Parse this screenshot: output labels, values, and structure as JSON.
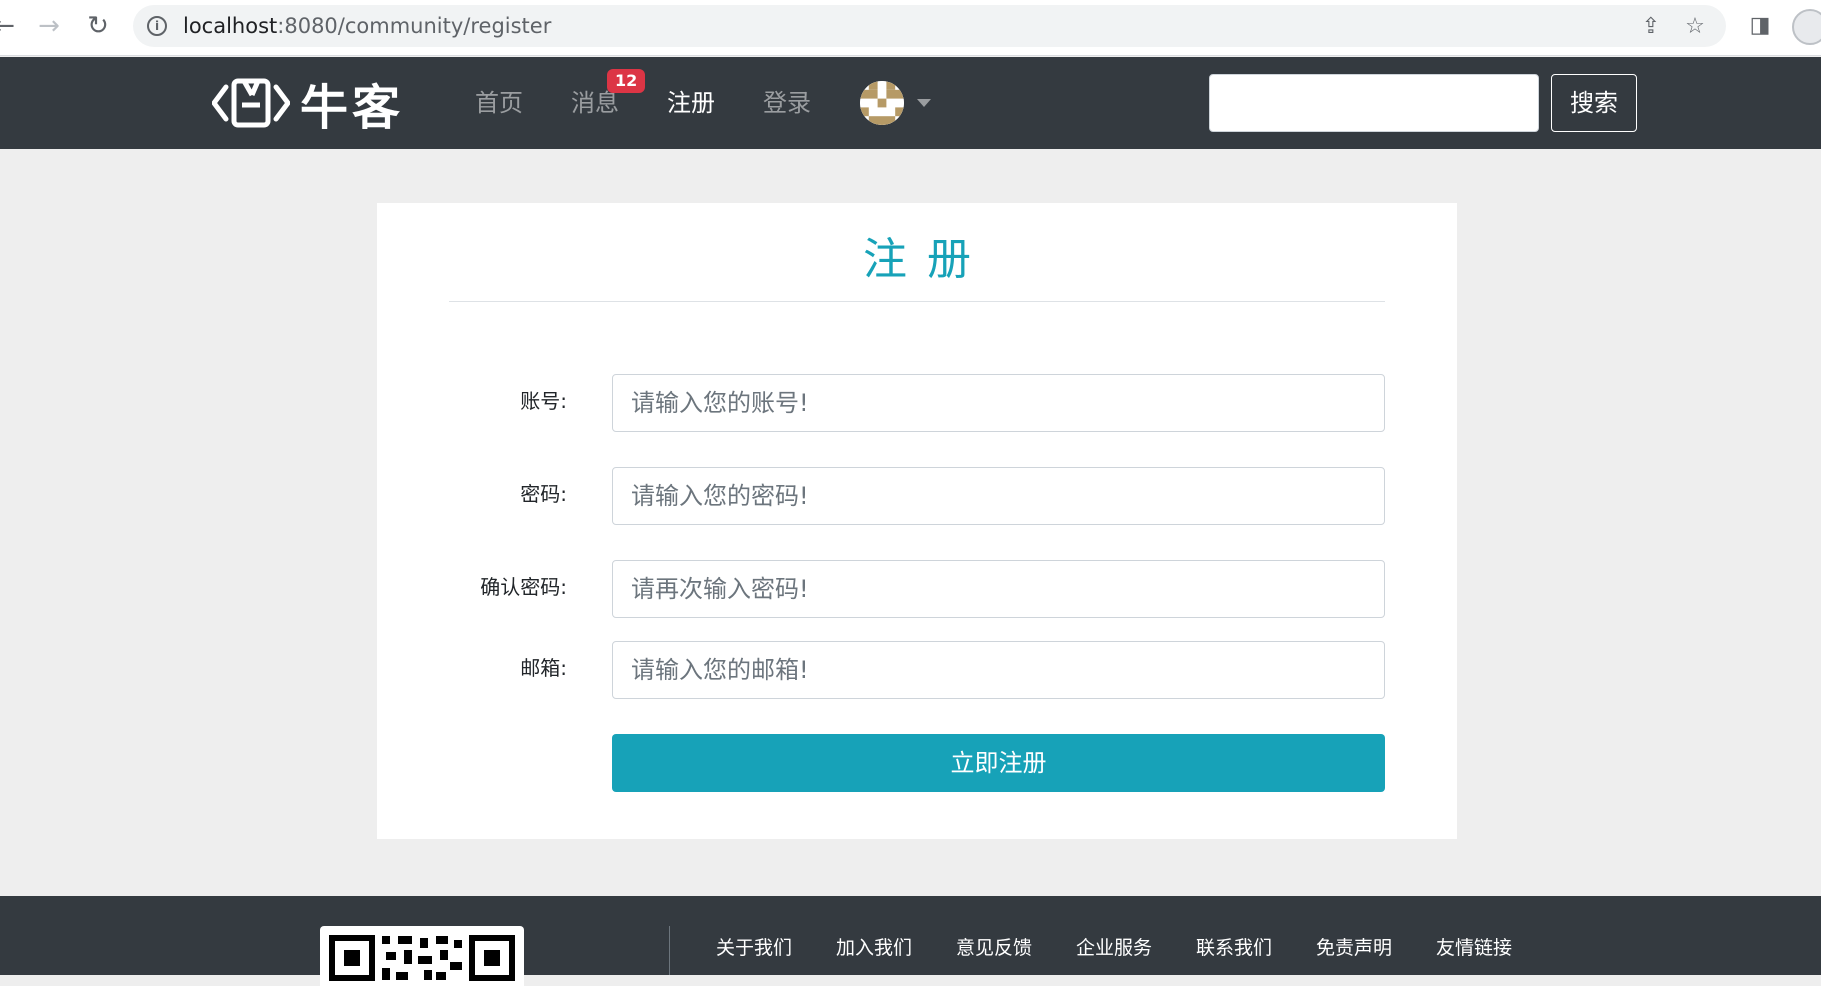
{
  "browser": {
    "url_host": "localhost",
    "url_rest": ":8080/community/register"
  },
  "header": {
    "logo_text": "牛客",
    "nav": [
      {
        "label": "首页"
      },
      {
        "label": "消息"
      },
      {
        "label": "注册"
      },
      {
        "label": "登录"
      }
    ],
    "message_badge": "12",
    "search_button": "搜索",
    "search_value": ""
  },
  "form": {
    "title": "注册",
    "fields": [
      {
        "label": "账号:",
        "placeholder": "请输入您的账号!"
      },
      {
        "label": "密码:",
        "placeholder": "请输入您的密码!"
      },
      {
        "label": "确认密码:",
        "placeholder": "请再次输入密码!"
      },
      {
        "label": "邮箱:",
        "placeholder": "请输入您的邮箱!"
      }
    ],
    "submit": "立即注册"
  },
  "footer": {
    "links": [
      "关于我们",
      "加入我们",
      "意见反馈",
      "企业服务",
      "联系我们",
      "免责声明",
      "友情链接"
    ]
  },
  "colors": {
    "header_bg": "#343a40",
    "accent": "#17a2b8",
    "badge": "#dc3545",
    "page_bg": "#eeeeee"
  }
}
